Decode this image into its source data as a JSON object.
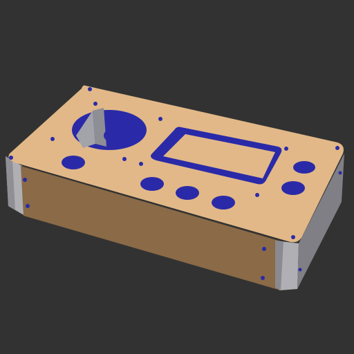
{
  "viewport": {
    "background": "#323232"
  },
  "model": {
    "object": "enclosure-box",
    "colors": {
      "top_face": "#e2b888",
      "front_face": "#8a6a47",
      "side_face": "#b0b0b4",
      "side_shadow": "#7f7f85",
      "hole_interior": "#2a2aa8",
      "hole_shadow": "#1d1d70",
      "cutout_wall": "#a3a3aa"
    }
  }
}
